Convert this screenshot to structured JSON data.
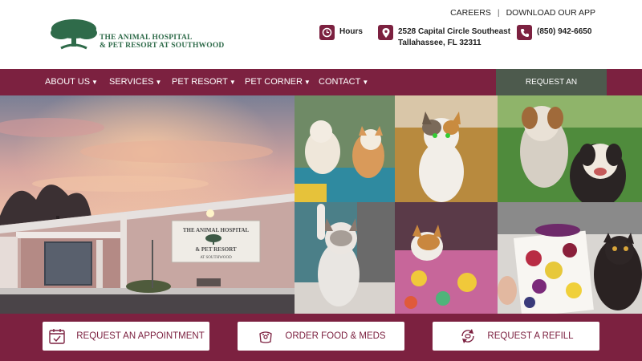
{
  "header": {
    "logo_line1": "THE ANIMAL HOSPITAL",
    "logo_line2": "& PET RESORT AT SOUTHWOOD",
    "top_links": [
      "CAREERS",
      "DOWNLOAD OUR APP"
    ],
    "separator": "|",
    "hours_label": "Hours",
    "address_line1": "2528 Capital Circle Southeast",
    "address_line2": "Tallahassee, FL 32311",
    "phone": "(850) 942-6650"
  },
  "nav": {
    "items": [
      {
        "label": "ABOUT US"
      },
      {
        "label": "SERVICES"
      },
      {
        "label": "PET RESORT"
      },
      {
        "label": "PET CORNER"
      },
      {
        "label": "CONTACT"
      }
    ],
    "cta": "REQUEST AN APPOINTMENT"
  },
  "hero": {
    "sign_line1": "THE ANIMAL HOSPITAL",
    "sign_line2": "& PET RESORT",
    "sign_line3": "AT SOUTHWOOD"
  },
  "actions": [
    {
      "label": "REQUEST AN APPOINTMENT",
      "icon": "calendar-check-icon"
    },
    {
      "label": "ORDER FOOD & MEDS",
      "icon": "pet-food-icon"
    },
    {
      "label": "REQUEST A REFILL",
      "icon": "refill-icon"
    }
  ],
  "colors": {
    "brand": "#7c2140",
    "cta_bg": "#4d5a4d",
    "logo_green": "#2f6b4a"
  }
}
